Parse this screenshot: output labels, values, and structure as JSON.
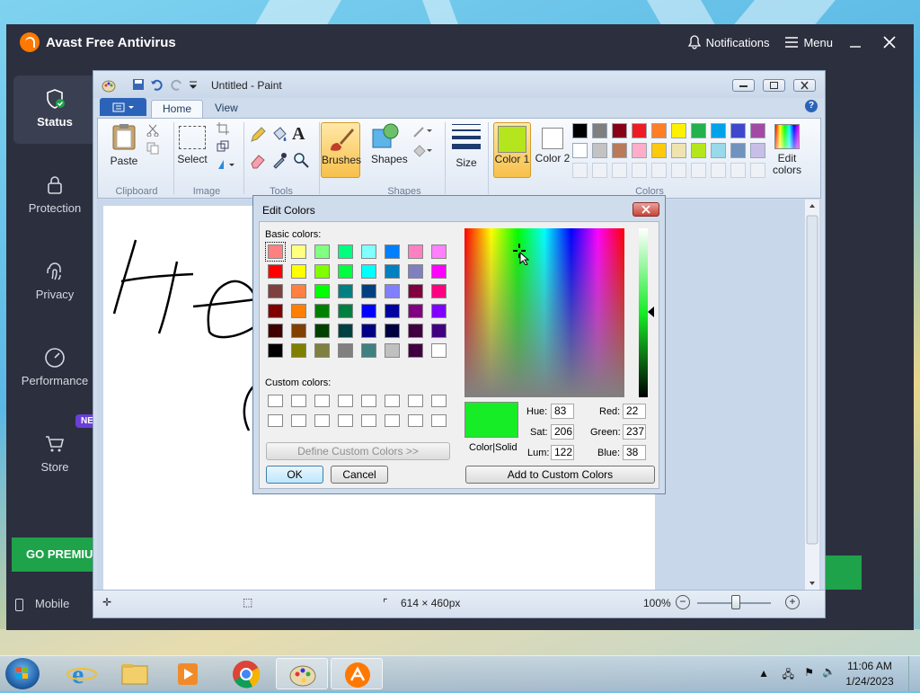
{
  "avast": {
    "title": "Avast Free Antivirus",
    "notifications": "Notifications",
    "menu": "Menu",
    "sidebar": [
      {
        "label": "Status",
        "icon": "shield-check-icon"
      },
      {
        "label": "Protection",
        "icon": "lock-icon"
      },
      {
        "label": "Privacy",
        "icon": "fingerprint-icon"
      },
      {
        "label": "Performance",
        "icon": "speedometer-icon"
      },
      {
        "label": "Store",
        "icon": "cart-icon"
      }
    ],
    "new_badge": "NE",
    "go_premium": "GO PREMIU",
    "mobile": "Mobile"
  },
  "paint": {
    "title": "Untitled - Paint",
    "tabs": {
      "home": "Home",
      "view": "View"
    },
    "ribbon": {
      "paste": "Paste",
      "select": "Select",
      "brushes": "Brushes",
      "shapes": "Shapes",
      "size": "Size",
      "color1": "Color 1",
      "color2": "Color 2",
      "edit_colors": "Edit colors",
      "groups": {
        "clipboard": "Clipboard",
        "image": "Image",
        "tools": "Tools",
        "shapes": "Shapes",
        "colors": "Colors"
      }
    },
    "palette_row1": [
      "#000000",
      "#7f7f7f",
      "#880015",
      "#ed1c24",
      "#ff7f27",
      "#fff200",
      "#22b14c",
      "#00a2e8",
      "#3f48cc",
      "#a349a4"
    ],
    "palette_row2": [
      "#ffffff",
      "#c3c3c3",
      "#b97a57",
      "#ffaec9",
      "#ffc90e",
      "#efe4b0",
      "#b5e61d",
      "#99d9ea",
      "#7092be",
      "#c8bfe7"
    ],
    "color1_value": "#b5e61d",
    "status": {
      "dimensions": "614 × 460px",
      "zoom": "100%"
    }
  },
  "edit_colors": {
    "title": "Edit Colors",
    "basic_colors_label": "Basic colors:",
    "custom_colors_label": "Custom colors:",
    "define_custom": "Define Custom Colors >>",
    "ok": "OK",
    "cancel": "Cancel",
    "add_custom": "Add to Custom Colors",
    "color_solid": "Color|Solid",
    "hue_label": "Hue:",
    "hue": "83",
    "sat_label": "Sat:",
    "sat": "206",
    "lum_label": "Lum:",
    "lum": "122",
    "red_label": "Red:",
    "red": "22",
    "green_label": "Green:",
    "green": "237",
    "blue_label": "Blue:",
    "blue": "38",
    "preview_color": "#16ed26",
    "basic_colors": [
      [
        "#ff8080",
        "#ffff80",
        "#80ff80",
        "#00ff80",
        "#80ffff",
        "#0080ff",
        "#ff80c0",
        "#ff80ff"
      ],
      [
        "#ff0000",
        "#ffff00",
        "#80ff00",
        "#00ff40",
        "#00ffff",
        "#0080c0",
        "#8080c0",
        "#ff00ff"
      ],
      [
        "#804040",
        "#ff8040",
        "#00ff00",
        "#008080",
        "#004080",
        "#8080ff",
        "#800040",
        "#ff0080"
      ],
      [
        "#800000",
        "#ff8000",
        "#008000",
        "#008040",
        "#0000ff",
        "#0000a0",
        "#800080",
        "#8000ff"
      ],
      [
        "#400000",
        "#804000",
        "#004000",
        "#004040",
        "#000080",
        "#000040",
        "#400040",
        "#400080"
      ],
      [
        "#000000",
        "#808000",
        "#808040",
        "#808080",
        "#408080",
        "#c0c0c0",
        "#400040",
        "#ffffff"
      ]
    ]
  },
  "taskbar": {
    "time": "11:06 AM",
    "date": "1/24/2023"
  }
}
